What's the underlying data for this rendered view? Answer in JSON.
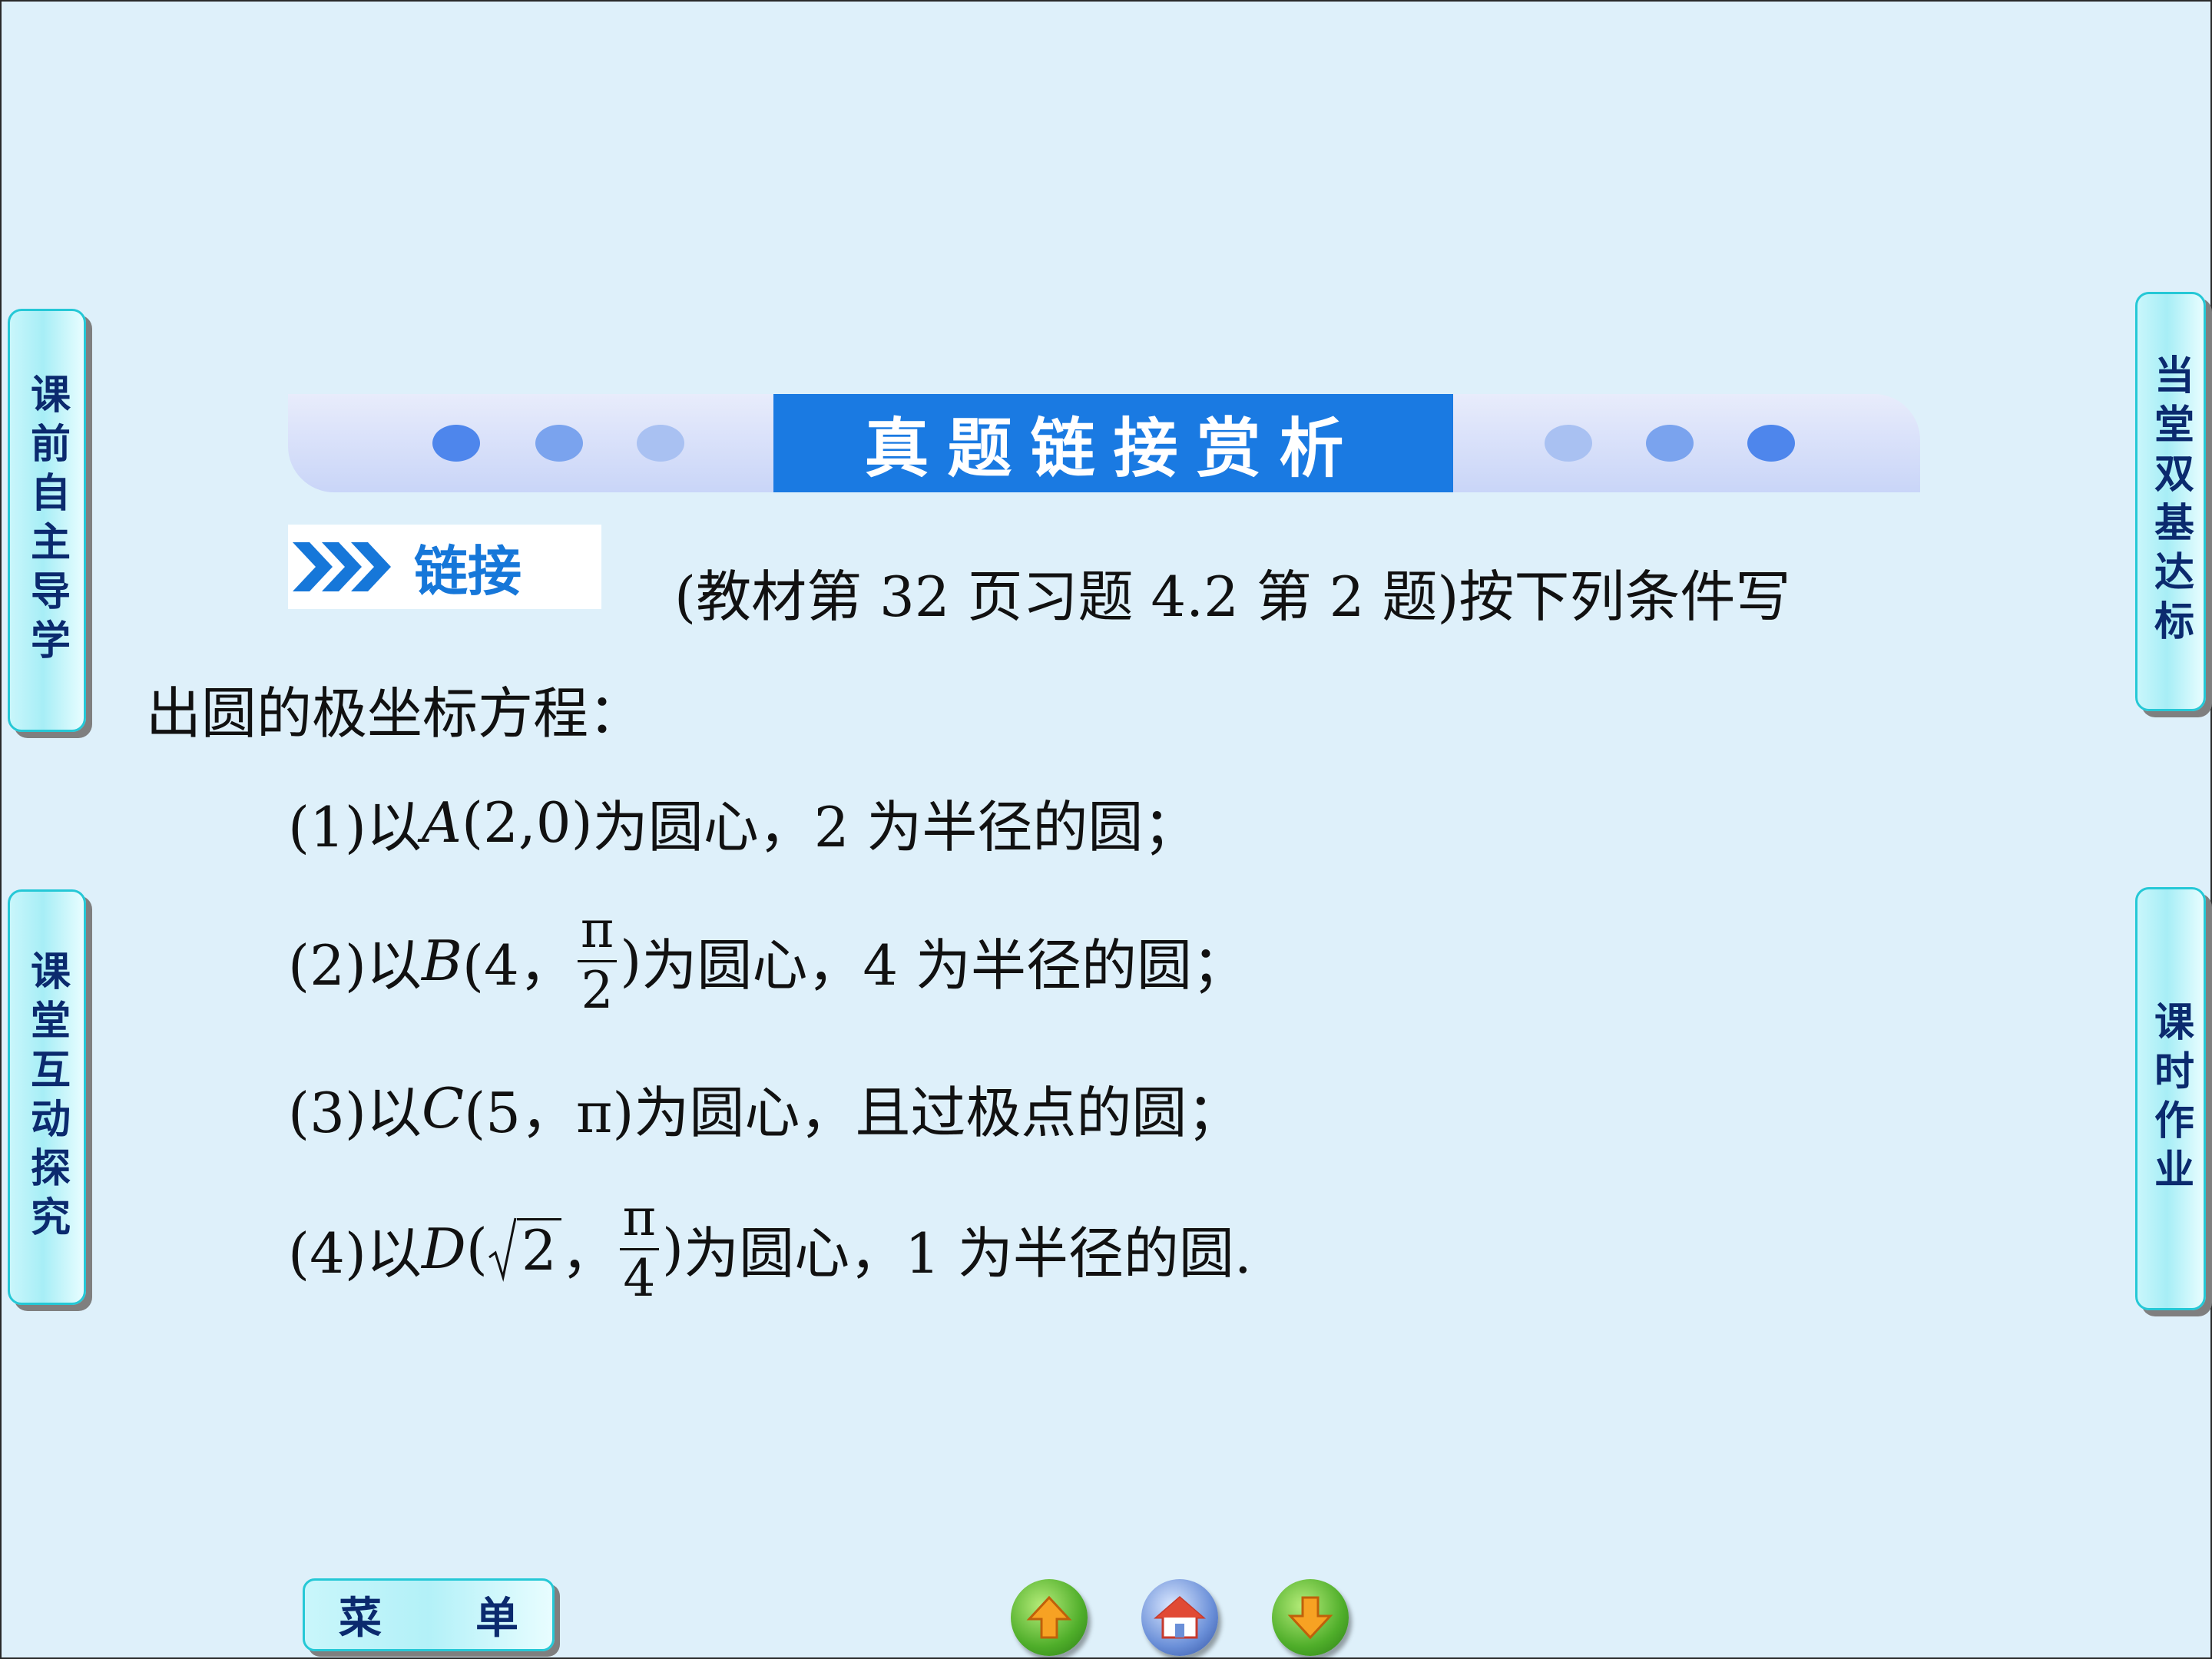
{
  "nav": {
    "left_top": "课前自主导学",
    "left_bottom": "课堂互动探究",
    "right_top": "当堂双基达标",
    "right_bottom": "课时作业"
  },
  "banner": {
    "title": "真题链接赏析"
  },
  "link_tag": {
    "label": "链接"
  },
  "problem": {
    "line1": "(教材第 32 页习题 4.2 第 2 题)按下列条件写",
    "line2": "出圆的极坐标方程：",
    "items": [
      {
        "prefix": "(1)以 ",
        "point": "A",
        "coords": "(2,0)",
        "rest": "为圆心，2 为半径的圆；"
      },
      {
        "prefix": "(2)以 ",
        "point": "B",
        "coords_open": "(4，",
        "frac_num": "π",
        "frac_den": "2",
        "coords_close": ")",
        "rest": "为圆心，4 为半径的圆；"
      },
      {
        "prefix": "(3)以 ",
        "point": "C",
        "coords": "(5，π)",
        "rest": "为圆心，且过极点的圆；"
      },
      {
        "prefix": "(4)以 ",
        "point": "D",
        "coords_open": "(",
        "radical": "2",
        "sep": "，",
        "frac_num": "π",
        "frac_den": "4",
        "coords_close": ")",
        "rest": "为圆心，1 为半径的圆."
      }
    ]
  },
  "bottom": {
    "menu_label_1": "菜",
    "menu_label_2": "单",
    "icons": [
      "up-arrow-icon",
      "home-icon",
      "down-arrow-icon"
    ]
  },
  "colors": {
    "background": "#def0fa",
    "banner_blue": "#1a7ae2",
    "tab_border": "#25c8d6",
    "link_blue": "#1677d9"
  }
}
